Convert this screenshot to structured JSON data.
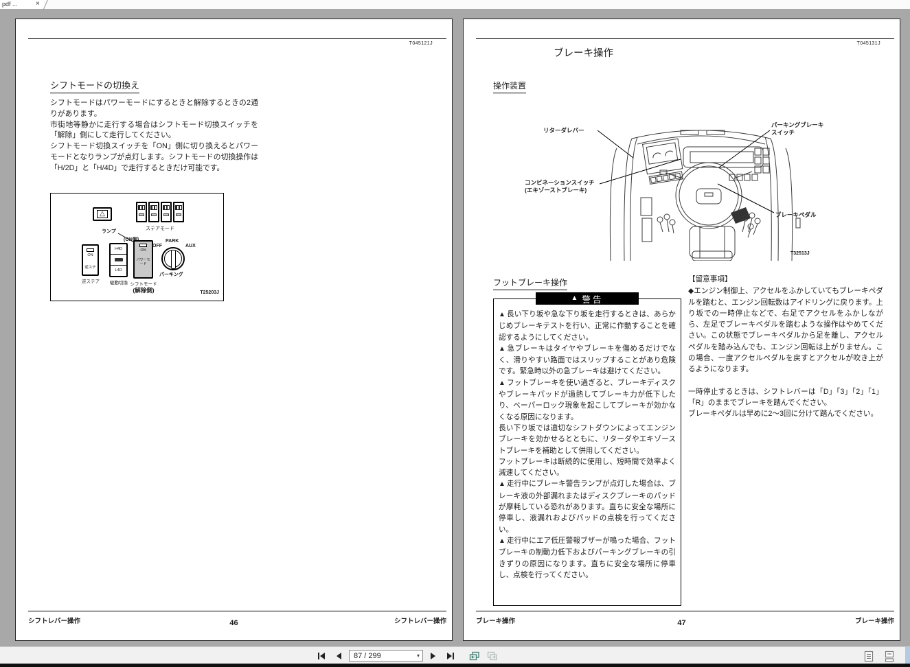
{
  "tab": {
    "title": "pdf ...",
    "close": "×"
  },
  "icons": {
    "dropdown_caret": "▾",
    "hazard_triangle": "△",
    "warning_triangle": "▲"
  },
  "toolbar": {
    "page_indicator": "87 / 299"
  },
  "left_page": {
    "doc_code": "T045121J",
    "heading": "シフトモードの切換え",
    "paragraphs": {
      "p0": "シフトモードはパワーモードにするときと解除するときの2通りがあります。",
      "p1": "市街地等静かに走行する場合はシフトモード切換スイッチを「解除」側にして走行してください。",
      "p2": "シフトモード切換スイッチを「ON」側に切り換えるとパワーモードとなりランプが点灯します。シフトモードの切換操作は「H/2D」と「H/4D」で走行するときだけ可能です。"
    },
    "figure": {
      "code": "T25203J",
      "lamp_label": "ランプ",
      "on_side_label": "(ON側)",
      "steer_mode_label": "ステアモード",
      "release_side_label": "(解除側)",
      "sw_reverse": {
        "top": "ON",
        "bottom": "逆ステ",
        "label": "逆ステア"
      },
      "sw_drive": {
        "top": "H4D",
        "bottom": "L4D",
        "label": "駆動切換"
      },
      "sw_shift": {
        "top": "ON",
        "mode": "パワーモード",
        "label": "シフトモード"
      },
      "rotary": {
        "park": "PARK",
        "off": "OFF",
        "aux": "AUX",
        "label": "パーキング"
      }
    },
    "footer": {
      "left": "シフトレバー操作",
      "page": "46",
      "right": "シフトレバー操作"
    }
  },
  "right_page": {
    "doc_code": "T045131J",
    "title": "ブレーキ操作",
    "section1": "操作装置",
    "figure": {
      "code": "T32513J",
      "retarder": "リターダレバー",
      "parking_line1": "パーキングブレーキ",
      "parking_line2": "スイッチ",
      "combination_line1": "コンビネーションスイッチ",
      "combination_line2": "(エキゾーストブレーキ)",
      "pedal": "ブレーキペダル"
    },
    "section2": "フットブレーキ操作",
    "warning": {
      "header": "警告",
      "items": [
        {
          "m": "▲",
          "text": "長い下り坂や急な下り坂を走行するときは、あらかじめブレーキテストを行い、正常に作動することを確認するようにしてください。"
        },
        {
          "m": "▲",
          "text": "急ブレーキはタイヤやブレーキを傷めるだけでなく、滑りやすい路面ではスリップすることがあり危険です。緊急時以外の急ブレーキは避けてください。"
        },
        {
          "m": "▲",
          "text": "フットブレーキを使い過ぎると、ブレーキディスクやブレーキパッドが過熱してブレーキ力が低下したり、ベーパーロック現象を起こしてブレーキが効かなくなる原因になります。"
        },
        {
          "m": "",
          "text": "長い下り坂では適切なシフトダウンによってエンジンブレーキを効かせるとともに、リターダやエキゾーストブレーキを補助として併用してください。"
        },
        {
          "m": "",
          "text": "フットブレーキは断続的に使用し、短時間で効率よく減速してください。"
        },
        {
          "m": "▲",
          "text": "走行中にブレーキ警告ランプが点灯した場合は、ブレーキ液の外部漏れまたはディスクブレーキのパッドが摩耗している恐れがあります。直ちに安全な場所に停車し、液漏れおよびパッドの点検を行ってください。"
        },
        {
          "m": "▲",
          "text": "走行中にエア低圧警報ブザーが鳴った場合、フットブレーキの制動力低下およびパーキングブレーキの引きずりの原因になります。直ちに安全な場所に停車し、点検を行ってください。"
        }
      ]
    },
    "notes": {
      "header": "【留意事項】",
      "para1": "◆エンジン制御上、アクセルをふかしていてもブレーキペダルを踏むと、エンジン回転数はアイドリングに戻ります。上り坂での一時停止などで、右足でアクセルをふかしながら、左足でブレーキペダルを踏むような操作はやめてください。この状態でブレーキペダルから足を離し、アクセルペダルを踏み込んでも、エンジン回転は上がりません。この場合、一度アクセルペダルを戻すとアクセルが吹き上がるようになります。",
      "para2": "一時停止するときは、シフトレバーは「D」「3」「2」「1」「R」のままでブレーキを踏んでください。",
      "para3": "ブレーキペダルは早めに2～3回に分けて踏んでください。"
    },
    "footer": {
      "left": "ブレーキ操作",
      "page": "47",
      "right": "ブレーキ操作"
    }
  }
}
